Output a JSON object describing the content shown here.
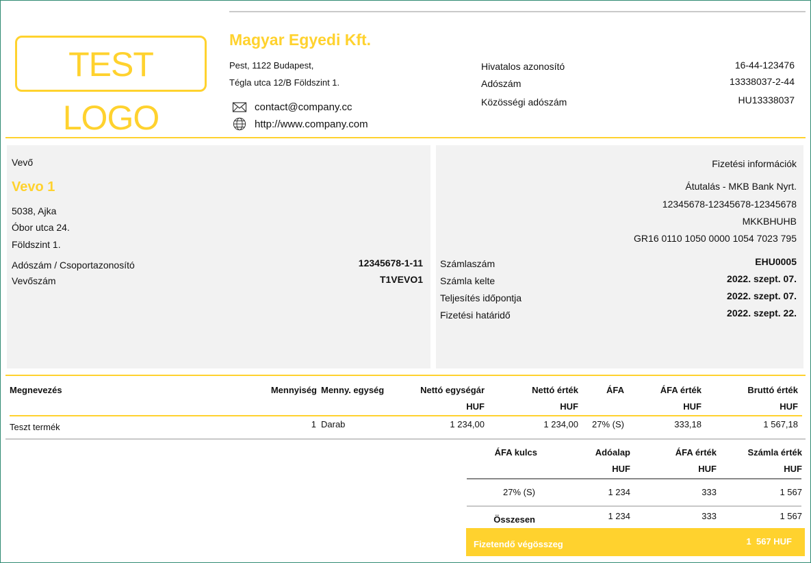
{
  "logo_text": "TEST LOGO",
  "seller": {
    "name": "Magyar Egyedi Kft.",
    "address_line1": "Pest, 1122 Budapest,",
    "address_line2": "Tégla utca 12/B Földszint 1.",
    "email": "contact@company.cc",
    "website": "http://www.company.com"
  },
  "ids": {
    "official_label": "Hivatalos azonosító",
    "official_value": "16-44-123476",
    "tax_label": "Adószám",
    "tax_value": "13338037-2-44",
    "eu_tax_label": "Közösségi adószám",
    "eu_tax_value": "HU13338037"
  },
  "buyer": {
    "heading": "Vevő",
    "name": "Vevo 1",
    "line1": "5038, Ajka",
    "line2": "Óbor utca 24.",
    "line3": "Földszint 1.",
    "tax_label": "Adószám / Csoportazonosító",
    "tax_value": "12345678-1-11",
    "customer_no_label": "Vevőszám",
    "customer_no_value": "T1VEVO1"
  },
  "payment": {
    "heading": "Fizetési információk",
    "method": "Átutalás - MKB Bank Nyrt.",
    "account": "12345678-12345678-12345678",
    "swift": "MKKBHUHB",
    "iban": "GR16 0110 1050 0000 1054 7023 795",
    "invoice_no_label": "Számlaszám",
    "invoice_no_value": "EHU0005",
    "invoice_date_label": "Számla kelte",
    "invoice_date_value": "2022. szept. 07.",
    "fulfilment_label": "Teljesítés időpontja",
    "fulfilment_value": "2022. szept. 07.",
    "due_label": "Fizetési határidő",
    "due_value": "2022. szept. 22."
  },
  "items_table": {
    "headers": {
      "name": "Megnevezés",
      "qty": "Mennyiség",
      "unit": "Menny. egység",
      "net_unit_price": "Nettó egységár",
      "net_value": "Nettó érték",
      "vat": "ÁFA",
      "vat_value": "ÁFA érték",
      "gross_value": "Bruttó érték",
      "currency": "HUF"
    },
    "rows": [
      {
        "name": "Teszt termék",
        "qty": "1",
        "unit": "Darab",
        "net_unit_price": "1 234,00",
        "net_value": "1 234,00",
        "vat": "27% (S)",
        "vat_value": "333,18",
        "gross_value": "1 567,18"
      }
    ]
  },
  "summary": {
    "headers": {
      "rate": "ÁFA kulcs",
      "base": "Adóalap",
      "vat_value": "ÁFA érték",
      "invoice_value": "Számla érték",
      "currency": "HUF"
    },
    "row": {
      "rate": "27% (S)",
      "base": "1 234",
      "vat_value": "333",
      "invoice_value": "1 567"
    },
    "total": {
      "label": "Összesen",
      "base": "1 234",
      "vat_value": "333",
      "invoice_value": "1 567"
    }
  },
  "payable": {
    "label": "Fizetendő végösszeg",
    "value": "1  567 HUF"
  }
}
